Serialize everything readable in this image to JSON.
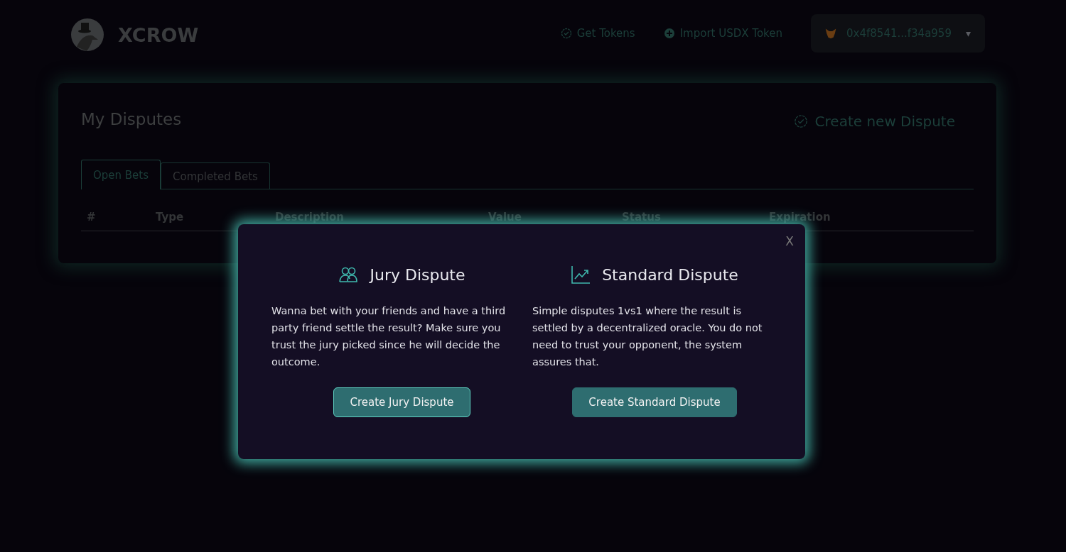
{
  "header": {
    "brand": "XCROW",
    "nav": [
      {
        "kind": "badge",
        "label": "Get Tokens"
      },
      {
        "kind": "plus",
        "label": "Import USDX Token"
      }
    ],
    "wallet": {
      "address": "0x4f8541...f34a959",
      "caret": "▾"
    }
  },
  "disputes": {
    "title": "My Disputes",
    "create_label": "Create new Dispute",
    "tabs": [
      {
        "label": "Open Bets",
        "selected": true
      },
      {
        "label": "Completed Bets",
        "selected": false
      }
    ],
    "table": {
      "columns": [
        "#",
        "Type",
        "Description",
        "Value",
        "Status",
        "Expiration"
      ]
    }
  },
  "modal": {
    "close": "X",
    "options": [
      {
        "kind": "jury",
        "title": "Jury Dispute",
        "text": "Wanna bet with your friends and have a third party friend settle the result? Make sure you trust the jury picked since he will decide the outcome.",
        "button": "Create Jury Dispute",
        "focused": true
      },
      {
        "kind": "standard",
        "title": "Standard Dispute",
        "text": "Simple disputes 1vs1 where the result is settled by a decentralized oracle. You do not need to trust your opponent, the system assures that.",
        "button": "Create Standard Dispute",
        "focused": false
      }
    ]
  }
}
